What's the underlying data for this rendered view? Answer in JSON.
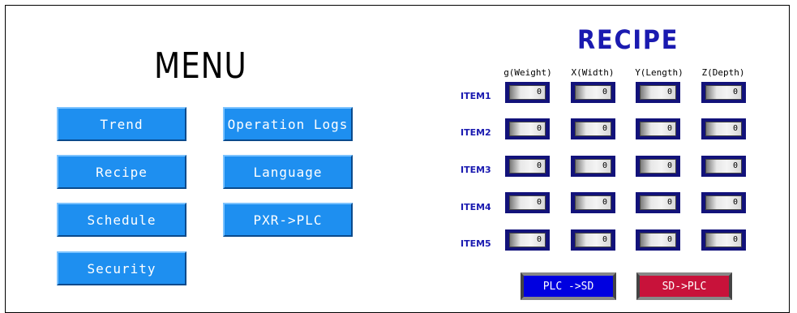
{
  "menu": {
    "title": "MENU",
    "buttons": {
      "trend": "Trend",
      "recipe": "Recipe",
      "schedule": "Schedule",
      "security": "Security",
      "operation_logs": "Operation Logs",
      "language": "Language",
      "pxr_plc": "PXR->PLC"
    }
  },
  "recipe": {
    "title": "RECIPE",
    "columns": [
      "g(Weight)",
      "X(Width)",
      "Y(Length)",
      "Z(Depth)"
    ],
    "rows": [
      {
        "label": "ITEM1",
        "values": [
          "0",
          "0",
          "0",
          "0"
        ]
      },
      {
        "label": "ITEM2",
        "values": [
          "0",
          "0",
          "0",
          "0"
        ]
      },
      {
        "label": "ITEM3",
        "values": [
          "0",
          "0",
          "0",
          "0"
        ]
      },
      {
        "label": "ITEM4",
        "values": [
          "0",
          "0",
          "0",
          "0"
        ]
      },
      {
        "label": "ITEM5",
        "values": [
          "0",
          "0",
          "0",
          "0"
        ]
      }
    ],
    "plc_to_sd": "PLC ->SD",
    "sd_to_plc": "SD->PLC"
  },
  "colors": {
    "menu_button": "#1e8ff0",
    "recipe_title": "#1a1ab0",
    "plc_to_sd_button": "#0000e0",
    "sd_to_plc_button": "#c8123a"
  }
}
